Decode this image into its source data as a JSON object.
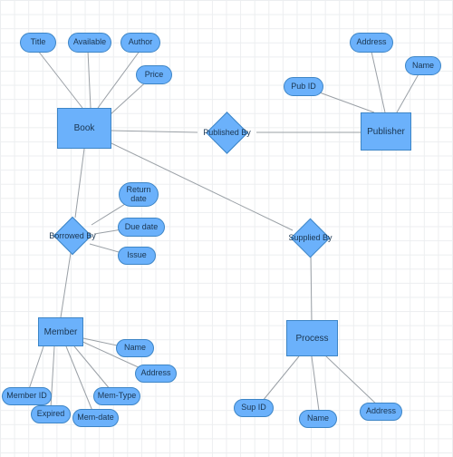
{
  "diagram": {
    "entities": {
      "book": "Book",
      "publisher": "Publisher",
      "member": "Member",
      "process": "Process"
    },
    "relationships": {
      "published_by": "Published By",
      "borrowed_by": "Borrowed By",
      "supplied_by": "Supplied By"
    },
    "attributes": {
      "book": {
        "title": "Title",
        "available": "Available",
        "author": "Author",
        "price": "Price"
      },
      "publisher": {
        "pub_id": "Pub ID",
        "address": "Address",
        "name": "Name"
      },
      "borrowed_by": {
        "return_date": "Return date",
        "due_date": "Due date",
        "issue": "Issue"
      },
      "member": {
        "name": "Name",
        "address": "Address",
        "mem_type": "Mem-Type",
        "mem_date": "Mem-date",
        "expired": "Expired",
        "member_id": "Member ID"
      },
      "process": {
        "sup_id": "Sup ID",
        "name": "Name",
        "address": "Address"
      }
    }
  },
  "chart_data": {
    "type": "table",
    "description": "Entity-Relationship diagram for a library system",
    "entities": [
      {
        "name": "Book",
        "attributes": [
          "Title",
          "Available",
          "Author",
          "Price"
        ]
      },
      {
        "name": "Publisher",
        "attributes": [
          "Pub ID",
          "Address",
          "Name"
        ]
      },
      {
        "name": "Member",
        "attributes": [
          "Name",
          "Address",
          "Mem-Type",
          "Mem-date",
          "Expired",
          "Member ID"
        ]
      },
      {
        "name": "Process",
        "attributes": [
          "Sup ID",
          "Name",
          "Address"
        ]
      }
    ],
    "relationships": [
      {
        "name": "Published By",
        "between": [
          "Book",
          "Publisher"
        ],
        "attributes": []
      },
      {
        "name": "Borrowed By",
        "between": [
          "Book",
          "Member"
        ],
        "attributes": [
          "Return date",
          "Due date",
          "Issue"
        ]
      },
      {
        "name": "Supplied By",
        "between": [
          "Book",
          "Process"
        ],
        "attributes": []
      }
    ]
  }
}
